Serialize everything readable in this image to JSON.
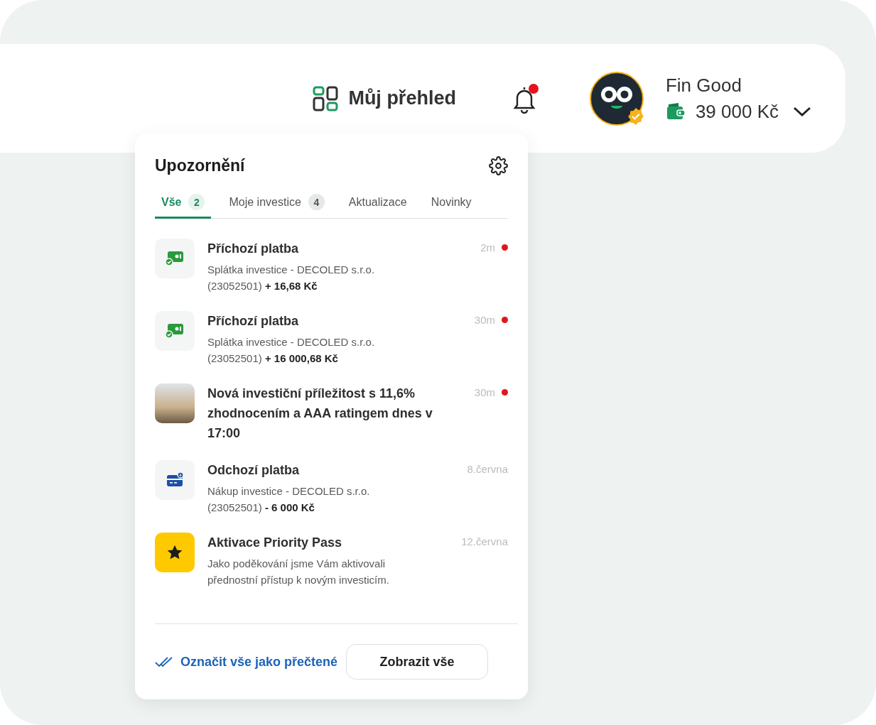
{
  "header": {
    "dashboard_link": "Můj přehled",
    "bell": {
      "has_unread": true
    },
    "user": {
      "name": "Fin Good",
      "balance": "39 000 Kč",
      "verified": true
    }
  },
  "notifications": {
    "title": "Upozornění",
    "tabs": [
      {
        "label": "Vše",
        "count": "2",
        "selected": true
      },
      {
        "label": "Moje investice",
        "count": "4",
        "selected": false
      },
      {
        "label": "Aktualizace",
        "selected": false
      },
      {
        "label": "Novinky",
        "selected": false
      }
    ],
    "items": [
      {
        "kind": "incoming",
        "title": "Příchozí platba",
        "lines": [
          "Splátka investice - DECOLED s.r.o.",
          "(23052501) **+ 16,68 Kč**"
        ],
        "time": "2m",
        "unread": true
      },
      {
        "kind": "incoming",
        "title": "Příchozí platba",
        "lines": [
          "Splátka investice - DECOLED s.r.o.",
          "(23052501) **+ 16 000,68 Kč**"
        ],
        "time": "30m",
        "unread": true
      },
      {
        "kind": "photo",
        "title": "Nová investiční příležitost s 11,6% zhodnocením a AAA ratingem dnes v 17:00",
        "time": "30m",
        "unread": true
      },
      {
        "kind": "outgoing",
        "title": "Odchozí platba",
        "lines": [
          "Nákup investice - DECOLED s.r.o.",
          "(23052501) **- 6 000 Kč**"
        ],
        "time": "8.června",
        "unread": false
      },
      {
        "kind": "star",
        "title": "Aktivace Priority Pass",
        "lines": [
          "Jako poděkování jsme Vám aktivovali",
          "přednostní přístup k novým investicím."
        ],
        "time": "12.června",
        "unread": false
      }
    ],
    "mark_all_read": "Označit vše jako přečtené",
    "show_all": "Zobrazit vše"
  }
}
